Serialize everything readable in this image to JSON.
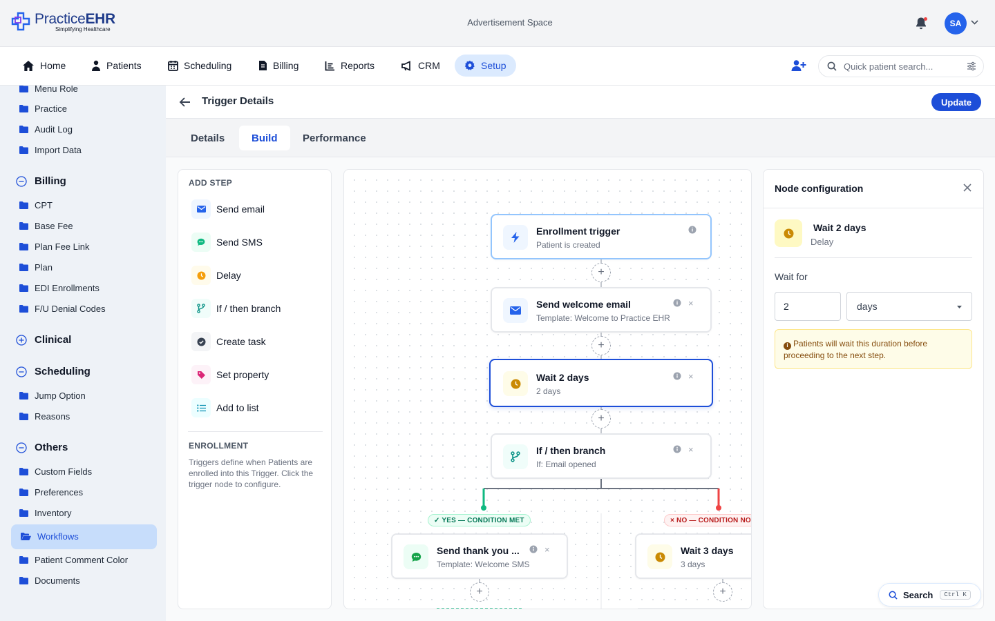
{
  "app": {
    "logo_name": "PracticeEHR",
    "logo_tagline": "Simplifying Healthcare",
    "ad_space": "Advertisement Space",
    "avatar_initials": "SA"
  },
  "nav": {
    "items": [
      {
        "label": "Home"
      },
      {
        "label": "Patients"
      },
      {
        "label": "Scheduling"
      },
      {
        "label": "Billing"
      },
      {
        "label": "Reports"
      },
      {
        "label": "CRM"
      },
      {
        "label": "Setup"
      }
    ],
    "active": "Setup",
    "search_placeholder": "Quick patient search..."
  },
  "sidebar": {
    "top_items": [
      "Menu Role",
      "Practice",
      "Audit Log",
      "Import Data"
    ],
    "groups": [
      {
        "label": "Billing",
        "expanded": true,
        "items": [
          "CPT",
          "Base Fee",
          "Plan Fee Link",
          "Plan",
          "EDI Enrollments",
          "F/U Denial Codes"
        ]
      },
      {
        "label": "Clinical",
        "expanded": false,
        "items": []
      },
      {
        "label": "Scheduling",
        "expanded": true,
        "items": [
          "Jump Option",
          "Reasons"
        ]
      },
      {
        "label": "Others",
        "expanded": true,
        "items": [
          "Custom Fields",
          "Preferences",
          "Inventory",
          "Workflows",
          "Patient Comment Color",
          "Documents"
        ]
      }
    ],
    "active_item": "Workflows"
  },
  "page": {
    "title": "Trigger Details",
    "update_label": "Update",
    "tabs": [
      "Details",
      "Build",
      "Performance"
    ],
    "active_tab": "Build"
  },
  "add_step": {
    "heading": "ADD STEP",
    "steps": [
      {
        "label": "Send email",
        "icon": "envelope-icon"
      },
      {
        "label": "Send SMS",
        "icon": "chat-bubble-icon"
      },
      {
        "label": "Delay",
        "icon": "clock-icon"
      },
      {
        "label": "If / then branch",
        "icon": "branch-icon"
      },
      {
        "label": "Create task",
        "icon": "check-circle-icon"
      },
      {
        "label": "Set property",
        "icon": "tag-icon"
      },
      {
        "label": "Add to list",
        "icon": "list-icon"
      }
    ],
    "enrollment_heading": "ENROLLMENT",
    "enrollment_text": "Triggers define when Patients are enrolled into this Trigger. Click the trigger node to configure."
  },
  "workflow": {
    "nodes": [
      {
        "title": "Enrollment trigger",
        "subtitle": "Patient is created"
      },
      {
        "title": "Send welcome email",
        "subtitle": "Template: Welcome to Practice EHR"
      },
      {
        "title": "Wait 2 days",
        "subtitle": "2 days"
      },
      {
        "title": "If / then branch",
        "subtitle": "If: Email opened"
      },
      {
        "title": "Send thank you ...",
        "subtitle": "Template: Welcome SMS"
      },
      {
        "title": "Wait 3 days",
        "subtitle": "3 days"
      }
    ],
    "yes_label": "✓ YES — CONDITION MET",
    "no_label": "× NO — CONDITION NOT MET",
    "plus_glyph": "+",
    "close_glyph": "×"
  },
  "config": {
    "heading": "Node configuration",
    "node_title": "Wait 2 days",
    "node_type": "Delay",
    "wait_label": "Wait for",
    "wait_value": "2",
    "wait_unit": "days",
    "note": "Patients will wait this duration before proceeding to the next step.",
    "note_icon": "i"
  },
  "search_widget": {
    "label": "Search",
    "shortcut": "Ctrl K"
  },
  "colors": {
    "brand": "#1d4ed8",
    "active_nav_bg": "#dbeafe",
    "yes_branch": "#10b981",
    "no_branch": "#ef4444"
  }
}
